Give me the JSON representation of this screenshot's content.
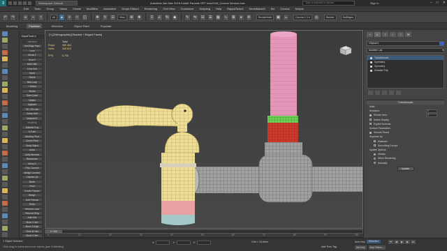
{
  "titlebar": {
    "logo": "3",
    "workspace": "Workspace: Default",
    "title": "Autodesk 3ds Max 2016   Kohler Faucets SET max2016_Corona Version.max",
    "search_placeholder": "Type a keyword or phrase",
    "signin": "Sign In",
    "win_min": "–",
    "win_max": "□",
    "win_close": "✕"
  },
  "menu": [
    "Edit",
    "Tools",
    "Group",
    "Views",
    "Create",
    "Modifiers",
    "Animation",
    "Graph Editors",
    "Rendering",
    "Civil View",
    "Customize",
    "Scripting",
    "Help",
    "RappaTools3",
    "DenisManix3",
    "Sel",
    "Corona",
    "Scripts"
  ],
  "toolbar": {
    "selection_set": "All",
    "view_mode": "View",
    "render_label": "RenderHold",
    "corona_version": "Corona 1.3.6",
    "render_btn": "Render",
    "setedges_btn": "SetEdges"
  },
  "ribbon_tabs": [
    "Modeling",
    "Freeform",
    "Selection",
    "Object Paint",
    "Populate"
  ],
  "viewport": {
    "label": "[+] [Orthographic] [Shaded + Edged Faces]",
    "stats_header": "Total",
    "polys_label": "Polys:",
    "polys_value": "380 464",
    "verts_label": "Verts:",
    "verts_value": "336 823",
    "fps_label": "FPS:",
    "fps_value": "6.708"
  },
  "graphite": {
    "title": "EqualTools 6",
    "items": [
      "Selection",
      "Vert  Edge  Face",
      "Loop",
      "Shrink F",
      "Grow F",
      "Multi Hide",
      "Clear Sub",
      "Invert",
      "Shrink",
      "Bind Loop",
      "+ Select",
      "Stroke",
      "Seen Quad",
      "Outline",
      "Adjacent",
      "Fill / Fill Hole",
      "Select Half",
      "Material ID",
      "Modeling",
      "Editable Poly",
      "X-Form",
      "Working Pivot",
      "Center Pivot",
      "Snap Object",
      "Lasso",
      "Unify Normals",
      "Randomize",
      "Mirror X",
      "Poly Connect",
      "Bridge Connect",
      "Chamfer Qs",
      "Bevel",
      "Push",
      "Create Polygon",
      "Bridge",
      "Split Polygon",
      "Relax",
      "Remove Loop",
      "Remove Ring",
      "Auto Kits",
      "Move 3 Vert",
      "Move 3 Edge",
      "Clear All Kits",
      "Move 3 Vert"
    ]
  },
  "cmdpanel": {
    "tabs": [
      "+",
      "◐",
      "≡",
      "○",
      "□",
      "⚒"
    ],
    "object_name": "Object01",
    "modifier_list": "Modifier List",
    "stack": [
      "TurboSmooth",
      "Symmetry",
      "Symmetry",
      "Editable Poly"
    ],
    "turbosmooth_title": "TurboSmooth",
    "main_label": "Main",
    "iterations_label": "Iterations:",
    "iterations_value": "1",
    "render_iters_label": "Render Iters:",
    "render_iters_value": "2",
    "isoline_label": "Isoline Display",
    "explicit_label": "Explicit Normals",
    "surface_label": "Surface Parameters",
    "smooth_result_label": "Smooth Result",
    "separate_label": "Separate by:",
    "materials_label": "Materials",
    "smoothing_label": "Smoothing Groups",
    "update_label": "Update Options",
    "always_label": "Always",
    "when_rendering_label": "When Rendering",
    "manually_label": "Manually",
    "update_btn": "Update"
  },
  "timeline": {
    "frame": "0 / 100",
    "ticks": [
      "0",
      "10",
      "20",
      "30",
      "40",
      "50",
      "60",
      "70",
      "80",
      "90",
      "100"
    ]
  },
  "status": {
    "selected": "1 Object Selected",
    "prompt": "Click-drag to select and move objects (pan Gridfinding)",
    "grid": "Grid = 10,0mm",
    "add_time_tag": "Add Time Tag",
    "autokey": "Auto Key",
    "selected_dd": "Selected",
    "set_key": "Set Key",
    "key_filters": "Key Filters..."
  },
  "colors": {
    "accent": "#3d6f96",
    "pipe_pink": "#e596b8",
    "ring_red": "#cc3b2b",
    "ring_green": "#6fd05a",
    "mesh_grey": "#9b9b9b",
    "handle_yellow": "#eedd95",
    "base_pink": "#e8a2a2",
    "base_cyan": "#a2c8c8"
  }
}
